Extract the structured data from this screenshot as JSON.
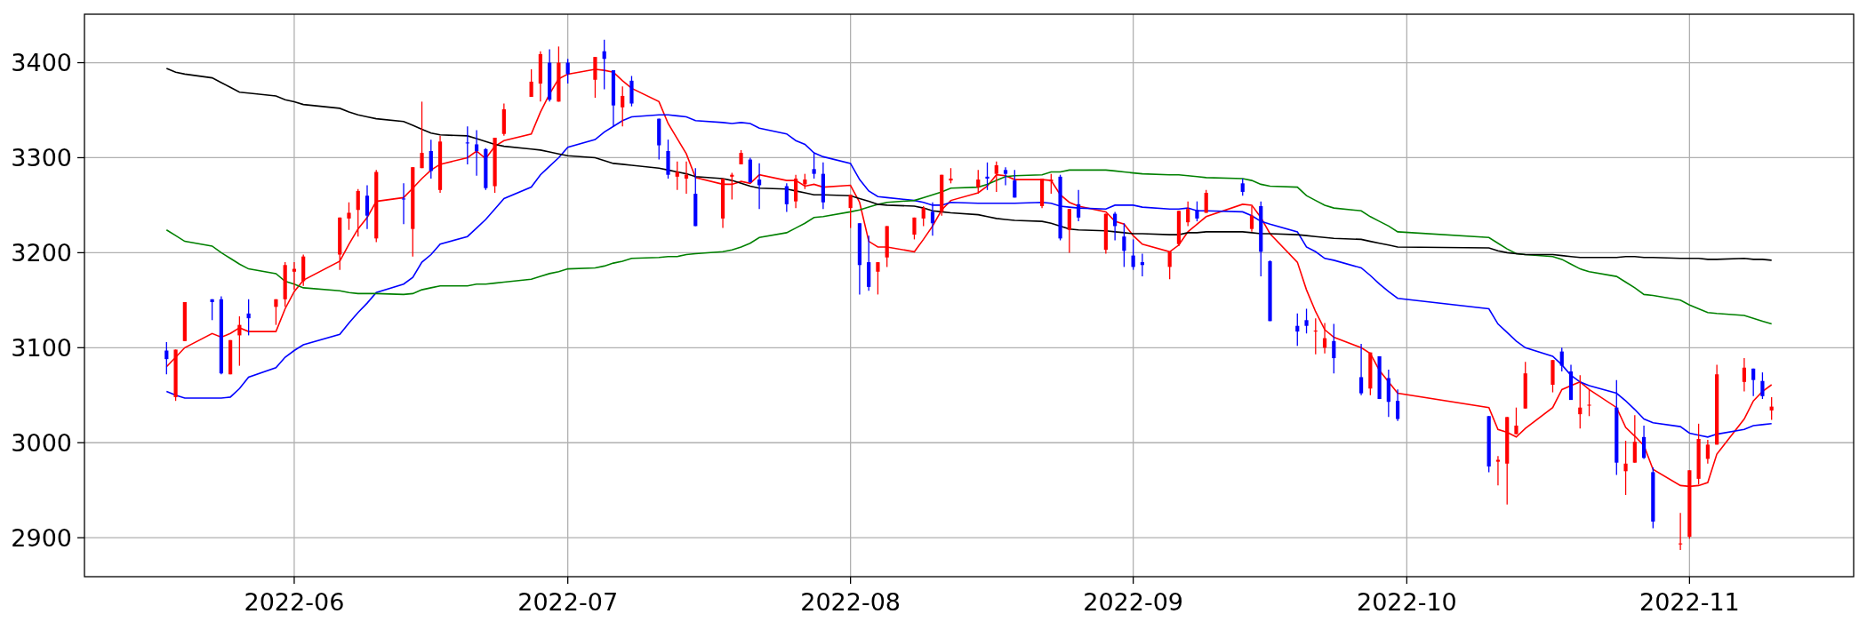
{
  "chart_data": {
    "type": "candlestick",
    "grid": true,
    "x": [
      "2022-05-18",
      "2022-05-19",
      "2022-05-20",
      "2022-05-23",
      "2022-05-24",
      "2022-05-25",
      "2022-05-26",
      "2022-05-27",
      "2022-05-30",
      "2022-05-31",
      "2022-06-01",
      "2022-06-02",
      "2022-06-06",
      "2022-06-07",
      "2022-06-08",
      "2022-06-09",
      "2022-06-10",
      "2022-06-13",
      "2022-06-14",
      "2022-06-15",
      "2022-06-16",
      "2022-06-17",
      "2022-06-20",
      "2022-06-21",
      "2022-06-22",
      "2022-06-23",
      "2022-06-24",
      "2022-06-27",
      "2022-06-28",
      "2022-06-29",
      "2022-06-30",
      "2022-07-01",
      "2022-07-04",
      "2022-07-05",
      "2022-07-06",
      "2022-07-07",
      "2022-07-08",
      "2022-07-11",
      "2022-07-12",
      "2022-07-13",
      "2022-07-14",
      "2022-07-15",
      "2022-07-18",
      "2022-07-19",
      "2022-07-20",
      "2022-07-21",
      "2022-07-22",
      "2022-07-25",
      "2022-07-26",
      "2022-07-27",
      "2022-07-28",
      "2022-07-29",
      "2022-08-01",
      "2022-08-02",
      "2022-08-03",
      "2022-08-04",
      "2022-08-05",
      "2022-08-08",
      "2022-08-09",
      "2022-08-10",
      "2022-08-11",
      "2022-08-12",
      "2022-08-15",
      "2022-08-16",
      "2022-08-17",
      "2022-08-18",
      "2022-08-19",
      "2022-08-22",
      "2022-08-23",
      "2022-08-24",
      "2022-08-25",
      "2022-08-26",
      "2022-08-29",
      "2022-08-30",
      "2022-08-31",
      "2022-09-01",
      "2022-09-02",
      "2022-09-05",
      "2022-09-06",
      "2022-09-07",
      "2022-09-08",
      "2022-09-09",
      "2022-09-13",
      "2022-09-14",
      "2022-09-15",
      "2022-09-16",
      "2022-09-19",
      "2022-09-20",
      "2022-09-21",
      "2022-09-22",
      "2022-09-23",
      "2022-09-26",
      "2022-09-27",
      "2022-09-28",
      "2022-09-29",
      "2022-09-30",
      "2022-10-10",
      "2022-10-11",
      "2022-10-12",
      "2022-10-13",
      "2022-10-14",
      "2022-10-17",
      "2022-10-18",
      "2022-10-19",
      "2022-10-20",
      "2022-10-21",
      "2022-10-24",
      "2022-10-25",
      "2022-10-26",
      "2022-10-27",
      "2022-10-28",
      "2022-10-31",
      "2022-11-01",
      "2022-11-02",
      "2022-11-03",
      "2022-11-04",
      "2022-11-07",
      "2022-11-08",
      "2022-11-09",
      "2022-11-10"
    ],
    "ohlc": [
      [
        3097,
        3106,
        3072,
        3088
      ],
      [
        3048,
        3098,
        3044,
        3098
      ],
      [
        3107,
        3148,
        3107,
        3148
      ],
      [
        3151,
        3151,
        3129,
        3148
      ],
      [
        3151,
        3154,
        3072,
        3073
      ],
      [
        3072,
        3108,
        3072,
        3108
      ],
      [
        3113,
        3133,
        3081,
        3124
      ],
      [
        3136,
        3151,
        3113,
        3131
      ],
      [
        3143,
        3151,
        3124,
        3151
      ],
      [
        3151,
        3190,
        3143,
        3187
      ],
      [
        3180,
        3190,
        3161,
        3183
      ],
      [
        3170,
        3198,
        3165,
        3196
      ],
      [
        3198,
        3237,
        3182,
        3237
      ],
      [
        3236,
        3253,
        3224,
        3242
      ],
      [
        3245,
        3267,
        3217,
        3265
      ],
      [
        3260,
        3271,
        3225,
        3239
      ],
      [
        3215,
        3287,
        3211,
        3285
      ],
      [
        3257,
        3273,
        3230,
        3256
      ],
      [
        3225,
        3290,
        3196,
        3290
      ],
      [
        3289,
        3359,
        3289,
        3305
      ],
      [
        3307,
        3319,
        3278,
        3286
      ],
      [
        3266,
        3323,
        3263,
        3317
      ],
      [
        3316,
        3333,
        3293,
        3315
      ],
      [
        3314,
        3329,
        3281,
        3307
      ],
      [
        3309,
        3310,
        3266,
        3268
      ],
      [
        3270,
        3321,
        3263,
        3321
      ],
      [
        3325,
        3357,
        3323,
        3351
      ],
      [
        3364,
        3393,
        3364,
        3380
      ],
      [
        3378,
        3412,
        3359,
        3409
      ],
      [
        3400,
        3414,
        3359,
        3361
      ],
      [
        3359,
        3417,
        3359,
        3400
      ],
      [
        3400,
        3404,
        3378,
        3388
      ],
      [
        3382,
        3406,
        3363,
        3406
      ],
      [
        3412,
        3424,
        3372,
        3404
      ],
      [
        3392,
        3392,
        3333,
        3355
      ],
      [
        3353,
        3375,
        3333,
        3365
      ],
      [
        3381,
        3386,
        3354,
        3357
      ],
      [
        3341,
        3341,
        3298,
        3313
      ],
      [
        3307,
        3319,
        3278,
        3282
      ],
      [
        3280,
        3296,
        3266,
        3285
      ],
      [
        3278,
        3296,
        3262,
        3282
      ],
      [
        3262,
        3289,
        3228,
        3228
      ],
      [
        3236,
        3278,
        3226,
        3278
      ],
      [
        3280,
        3284,
        3256,
        3282
      ],
      [
        3293,
        3308,
        3293,
        3305
      ],
      [
        3298,
        3300,
        3274,
        3274
      ],
      [
        3277,
        3294,
        3246,
        3271
      ],
      [
        3270,
        3273,
        3243,
        3251
      ],
      [
        3254,
        3282,
        3247,
        3278
      ],
      [
        3272,
        3283,
        3267,
        3277
      ],
      [
        3288,
        3305,
        3278,
        3283
      ],
      [
        3283,
        3295,
        3246,
        3253
      ],
      [
        3247,
        3261,
        3226,
        3261
      ],
      [
        3231,
        3231,
        3156,
        3187
      ],
      [
        3190,
        3218,
        3160,
        3164
      ],
      [
        3180,
        3190,
        3156,
        3190
      ],
      [
        3195,
        3228,
        3185,
        3228
      ],
      [
        3219,
        3237,
        3214,
        3237
      ],
      [
        3236,
        3249,
        3228,
        3247
      ],
      [
        3243,
        3253,
        3218,
        3231
      ],
      [
        3243,
        3282,
        3239,
        3282
      ],
      [
        3276,
        3289,
        3273,
        3278
      ],
      [
        3269,
        3287,
        3262,
        3277
      ],
      [
        3280,
        3295,
        3266,
        3278
      ],
      [
        3283,
        3296,
        3264,
        3292
      ],
      [
        3287,
        3290,
        3271,
        3283
      ],
      [
        3276,
        3287,
        3258,
        3258
      ],
      [
        3249,
        3278,
        3247,
        3278
      ],
      [
        3275,
        3283,
        3262,
        3277
      ],
      [
        3280,
        3282,
        3213,
        3215
      ],
      [
        3224,
        3246,
        3200,
        3246
      ],
      [
        3251,
        3266,
        3233,
        3237
      ],
      [
        3203,
        3241,
        3199,
        3241
      ],
      [
        3241,
        3243,
        3213,
        3228
      ],
      [
        3217,
        3231,
        3185,
        3202
      ],
      [
        3197,
        3214,
        3182,
        3185
      ],
      [
        3190,
        3199,
        3175,
        3187
      ],
      [
        3185,
        3201,
        3172,
        3201
      ],
      [
        3209,
        3244,
        3207,
        3244
      ],
      [
        3232,
        3254,
        3228,
        3246
      ],
      [
        3245,
        3254,
        3233,
        3236
      ],
      [
        3242,
        3266,
        3242,
        3263
      ],
      [
        3273,
        3278,
        3260,
        3264
      ],
      [
        3225,
        3249,
        3222,
        3239
      ],
      [
        3249,
        3254,
        3175,
        3201
      ],
      [
        3191,
        3192,
        3128,
        3128
      ],
      [
        3123,
        3136,
        3102,
        3117
      ],
      [
        3129,
        3141,
        3115,
        3123
      ],
      [
        3117,
        3131,
        3093,
        3118
      ],
      [
        3100,
        3126,
        3094,
        3110
      ],
      [
        3107,
        3125,
        3073,
        3089
      ],
      [
        3069,
        3104,
        3050,
        3052
      ],
      [
        3057,
        3095,
        3050,
        3095
      ],
      [
        3091,
        3091,
        3046,
        3046
      ],
      [
        3068,
        3077,
        3027,
        3043
      ],
      [
        3044,
        3056,
        3023,
        3025
      ],
      [
        3028,
        3028,
        2969,
        2975
      ],
      [
        2980,
        2986,
        2955,
        2982
      ],
      [
        2978,
        3027,
        2935,
        3027
      ],
      [
        3009,
        3037,
        3009,
        3018
      ],
      [
        3036,
        3085,
        3036,
        3073
      ],
      [
        3061,
        3087,
        3053,
        3087
      ],
      [
        3096,
        3100,
        3075,
        3081
      ],
      [
        3075,
        3082,
        3045,
        3045
      ],
      [
        3030,
        3071,
        3015,
        3037
      ],
      [
        3039,
        3056,
        3028,
        3040
      ],
      [
        3037,
        3066,
        2966,
        2979
      ],
      [
        2970,
        3002,
        2945,
        2978
      ],
      [
        2979,
        3029,
        2979,
        3001
      ],
      [
        3006,
        3018,
        2983,
        2984
      ],
      [
        2969,
        2974,
        2910,
        2917
      ],
      [
        2893,
        2926,
        2887,
        2894
      ],
      [
        2901,
        2971,
        2899,
        2971
      ],
      [
        2962,
        3020,
        2956,
        3004
      ],
      [
        2983,
        3003,
        2978,
        2998
      ],
      [
        2998,
        3082,
        2998,
        3072
      ],
      [
        3064,
        3089,
        3054,
        3079
      ],
      [
        3078,
        3078,
        3049,
        3066
      ],
      [
        3065,
        3074,
        3046,
        3049
      ],
      [
        3034,
        3048,
        3024,
        3038
      ]
    ],
    "series": [
      {
        "type": "line",
        "color": "#ff0000",
        "values": [
          3080,
          3090,
          3100,
          3115,
          3111,
          3115,
          3121,
          3117,
          3117,
          3141,
          3159,
          3171,
          3191,
          3209,
          3225,
          3237,
          3254,
          3258,
          3268,
          3278,
          3287,
          3293,
          3300,
          3307,
          3299,
          3312,
          3318,
          3325,
          3348,
          3367,
          3383,
          3388,
          3393,
          3392,
          3390,
          3381,
          3373,
          3359,
          3336,
          3320,
          3304,
          3279,
          3272,
          3272,
          3275,
          3273,
          3282,
          3276,
          3276,
          3270,
          3272,
          3269,
          3271,
          3253,
          3212,
          3206,
          3206,
          3201,
          3214,
          3228,
          3245,
          3255,
          3263,
          3270,
          3282,
          3281,
          3277,
          3277,
          3276,
          3261,
          3253,
          3249,
          3243,
          3233,
          3230,
          3218,
          3209,
          3201,
          3208,
          3222,
          3230,
          3238,
          3251,
          3250,
          3237,
          3220,
          3190,
          3161,
          3138,
          3119,
          3111,
          3100,
          3094,
          3076,
          3064,
          3052,
          3037,
          3014,
          3011,
          3006,
          3015,
          3037,
          3056,
          3060,
          3064,
          3056,
          3037,
          3016,
          3007,
          2997,
          2972,
          2955,
          2954,
          2955,
          2958,
          2988,
          3025,
          3044,
          3054,
          3061
        ]
      },
      {
        "type": "line",
        "color": "#0000ff",
        "values": [
          3054,
          3050,
          3047,
          3047,
          3047,
          3048,
          3057,
          3069,
          3079,
          3090,
          3097,
          3103,
          3114,
          3126,
          3137,
          3147,
          3158,
          3167,
          3174,
          3190,
          3198,
          3209,
          3217,
          3226,
          3235,
          3246,
          3257,
          3269,
          3282,
          3291,
          3300,
          3311,
          3319,
          3327,
          3333,
          3339,
          3343,
          3345,
          3345,
          3344,
          3343,
          3339,
          3337,
          3336,
          3337,
          3336,
          3331,
          3325,
          3318,
          3314,
          3305,
          3301,
          3294,
          3277,
          3265,
          3259,
          3258,
          3255,
          3253,
          3250,
          3250,
          3253,
          3252,
          3252,
          3252,
          3252,
          3252,
          3253,
          3252,
          3249,
          3248,
          3247,
          3246,
          3250,
          3250,
          3250,
          3248,
          3246,
          3246,
          3247,
          3244,
          3244,
          3243,
          3239,
          3233,
          3230,
          3222,
          3206,
          3201,
          3194,
          3192,
          3184,
          3176,
          3167,
          3159,
          3152,
          3141,
          3125,
          3116,
          3107,
          3100,
          3091,
          3082,
          3071,
          3064,
          3060,
          3052,
          3044,
          3035,
          3025,
          3021,
          3017,
          3010,
          3008,
          3006,
          3009,
          3014,
          3018,
          3019,
          3020
        ]
      },
      {
        "type": "line",
        "color": "#008000",
        "values": [
          3224,
          3218,
          3212,
          3207,
          3200,
          3194,
          3188,
          3183,
          3178,
          3170,
          3167,
          3163,
          3160,
          3158,
          3157,
          3157,
          3157,
          3156,
          3157,
          3161,
          3163,
          3165,
          3165,
          3167,
          3167,
          3168,
          3169,
          3172,
          3175,
          3178,
          3180,
          3183,
          3184,
          3186,
          3189,
          3191,
          3194,
          3195,
          3196,
          3196,
          3198,
          3199,
          3201,
          3203,
          3206,
          3210,
          3216,
          3221,
          3226,
          3231,
          3237,
          3238,
          3243,
          3245,
          3248,
          3251,
          3253,
          3255,
          3258,
          3261,
          3264,
          3268,
          3269,
          3272,
          3276,
          3280,
          3281,
          3282,
          3285,
          3285,
          3287,
          3287,
          3287,
          3286,
          3285,
          3284,
          3283,
          3282,
          3282,
          3281,
          3280,
          3279,
          3278,
          3276,
          3272,
          3270,
          3269,
          3260,
          3255,
          3250,
          3247,
          3244,
          3238,
          3233,
          3228,
          3222,
          3216,
          3210,
          3204,
          3199,
          3198,
          3196,
          3193,
          3188,
          3183,
          3180,
          3175,
          3169,
          3163,
          3156,
          3155,
          3150,
          3145,
          3141,
          3137,
          3136,
          3134,
          3131,
          3128,
          3125
        ]
      },
      {
        "type": "line",
        "color": "#000000",
        "values": [
          3394,
          3390,
          3388,
          3384,
          3379,
          3374,
          3369,
          3368,
          3365,
          3361,
          3359,
          3356,
          3352,
          3348,
          3345,
          3343,
          3341,
          3338,
          3334,
          3330,
          3326,
          3324,
          3323,
          3320,
          3317,
          3314,
          3312,
          3309,
          3308,
          3306,
          3304,
          3302,
          3300,
          3297,
          3294,
          3293,
          3292,
          3289,
          3287,
          3285,
          3283,
          3280,
          3278,
          3276,
          3273,
          3270,
          3268,
          3267,
          3265,
          3263,
          3261,
          3261,
          3260,
          3257,
          3254,
          3251,
          3250,
          3249,
          3247,
          3244,
          3243,
          3242,
          3240,
          3238,
          3236,
          3235,
          3234,
          3233,
          3231,
          3228,
          3225,
          3224,
          3223,
          3222,
          3221,
          3220,
          3220,
          3219,
          3219,
          3221,
          3221,
          3222,
          3222,
          3221,
          3220,
          3220,
          3219,
          3218,
          3217,
          3216,
          3215,
          3214,
          3212,
          3210,
          3208,
          3206,
          3205,
          3202,
          3200,
          3199,
          3198,
          3198,
          3197,
          3196,
          3195,
          3195,
          3195,
          3196,
          3196,
          3195,
          3195,
          3194,
          3194,
          3194,
          3193,
          3193,
          3194,
          3193,
          3193,
          3192
        ]
      }
    ],
    "xlim": [
      "2022-05-09",
      "2022-11-19"
    ],
    "ylim": [
      2859,
      3451
    ],
    "xticks": [
      {
        "value": "2022-06-01",
        "label": "2022-06"
      },
      {
        "value": "2022-07-01",
        "label": "2022-07"
      },
      {
        "value": "2022-08-01",
        "label": "2022-08"
      },
      {
        "value": "2022-09-01",
        "label": "2022-09"
      },
      {
        "value": "2022-10-01",
        "label": "2022-10"
      },
      {
        "value": "2022-11-01",
        "label": "2022-11"
      }
    ],
    "yticks": [
      2900,
      3000,
      3100,
      3200,
      3300,
      3400
    ]
  }
}
